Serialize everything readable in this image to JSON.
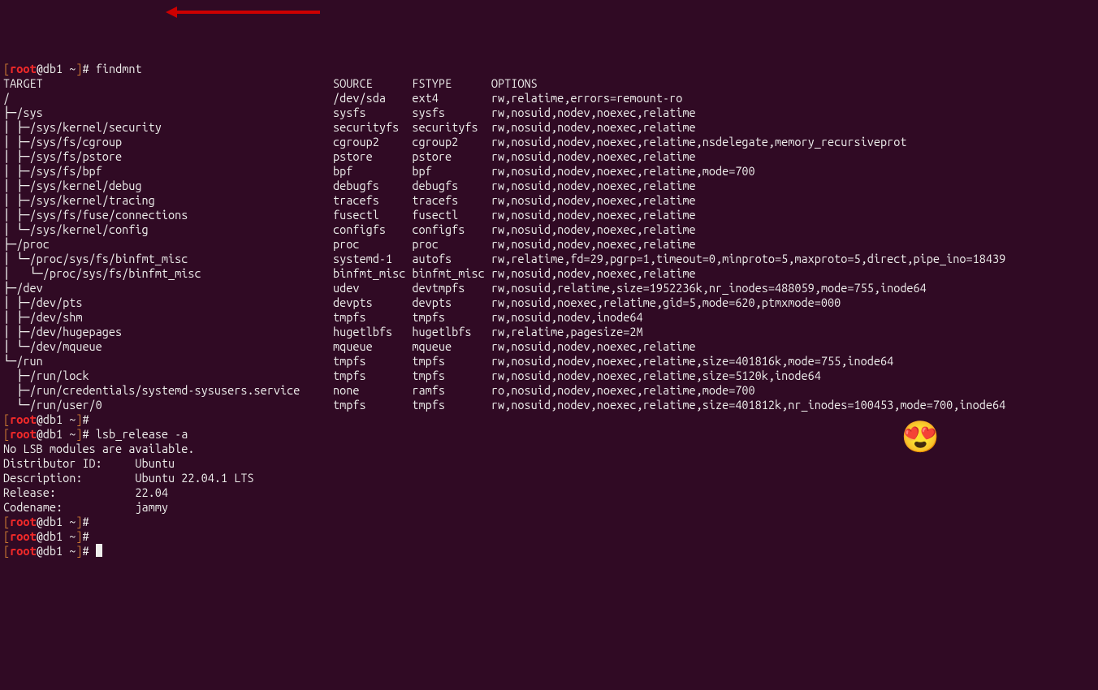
{
  "prompt": {
    "lb": "[",
    "user": "root",
    "at": "@",
    "host": "db1",
    "tilde": " ~",
    "rb": "]",
    "hash": "# "
  },
  "cmd1": "findmnt",
  "cmd2": "lsb_release -a",
  "header": {
    "target": "TARGET",
    "source": "SOURCE",
    "fstype": "FSTYPE",
    "options": "OPTIONS"
  },
  "rows": [
    {
      "t": "/",
      "s": "/dev/sda",
      "f": "ext4",
      "o": "rw,relatime,errors=remount-ro"
    },
    {
      "pre": "├─",
      "t": "/sys",
      "s": "sysfs",
      "f": "sysfs",
      "o": "rw,nosuid,nodev,noexec,relatime"
    },
    {
      "pre": "│ ├─",
      "t": "/sys/kernel/security",
      "s": "securityfs",
      "f": "securityfs",
      "o": "rw,nosuid,nodev,noexec,relatime"
    },
    {
      "pre": "│ ├─",
      "t": "/sys/fs/cgroup",
      "s": "cgroup2",
      "f": "cgroup2",
      "o": "rw,nosuid,nodev,noexec,relatime,nsdelegate,memory_recursiveprot"
    },
    {
      "pre": "│ ├─",
      "t": "/sys/fs/pstore",
      "s": "pstore",
      "f": "pstore",
      "o": "rw,nosuid,nodev,noexec,relatime"
    },
    {
      "pre": "│ ├─",
      "t": "/sys/fs/bpf",
      "s": "bpf",
      "f": "bpf",
      "o": "rw,nosuid,nodev,noexec,relatime,mode=700"
    },
    {
      "pre": "│ ├─",
      "t": "/sys/kernel/debug",
      "s": "debugfs",
      "f": "debugfs",
      "o": "rw,nosuid,nodev,noexec,relatime"
    },
    {
      "pre": "│ ├─",
      "t": "/sys/kernel/tracing",
      "s": "tracefs",
      "f": "tracefs",
      "o": "rw,nosuid,nodev,noexec,relatime"
    },
    {
      "pre": "│ ├─",
      "t": "/sys/fs/fuse/connections",
      "s": "fusectl",
      "f": "fusectl",
      "o": "rw,nosuid,nodev,noexec,relatime"
    },
    {
      "pre": "│ └─",
      "t": "/sys/kernel/config",
      "s": "configfs",
      "f": "configfs",
      "o": "rw,nosuid,nodev,noexec,relatime"
    },
    {
      "pre": "├─",
      "t": "/proc",
      "s": "proc",
      "f": "proc",
      "o": "rw,nosuid,nodev,noexec,relatime"
    },
    {
      "pre": "│ └─",
      "t": "/proc/sys/fs/binfmt_misc",
      "s": "systemd-1",
      "f": "autofs",
      "o": "rw,relatime,fd=29,pgrp=1,timeout=0,minproto=5,maxproto=5,direct,pipe_ino=18439"
    },
    {
      "pre": "│   └─",
      "t": "/proc/sys/fs/binfmt_misc",
      "s": "binfmt_misc",
      "f": "binfmt_misc",
      "o": "rw,nosuid,nodev,noexec,relatime"
    },
    {
      "pre": "├─",
      "t": "/dev",
      "s": "udev",
      "f": "devtmpfs",
      "o": "rw,nosuid,relatime,size=1952236k,nr_inodes=488059,mode=755,inode64"
    },
    {
      "pre": "│ ├─",
      "t": "/dev/pts",
      "s": "devpts",
      "f": "devpts",
      "o": "rw,nosuid,noexec,relatime,gid=5,mode=620,ptmxmode=000"
    },
    {
      "pre": "│ ├─",
      "t": "/dev/shm",
      "s": "tmpfs",
      "f": "tmpfs",
      "o": "rw,nosuid,nodev,inode64"
    },
    {
      "pre": "│ ├─",
      "t": "/dev/hugepages",
      "s": "hugetlbfs",
      "f": "hugetlbfs",
      "o": "rw,relatime,pagesize=2M"
    },
    {
      "pre": "│ └─",
      "t": "/dev/mqueue",
      "s": "mqueue",
      "f": "mqueue",
      "o": "rw,nosuid,nodev,noexec,relatime"
    },
    {
      "pre": "└─",
      "t": "/run",
      "s": "tmpfs",
      "f": "tmpfs",
      "o": "rw,nosuid,nodev,noexec,relatime,size=401816k,mode=755,inode64"
    },
    {
      "pre": "  ├─",
      "t": "/run/lock",
      "s": "tmpfs",
      "f": "tmpfs",
      "o": "rw,nosuid,nodev,noexec,relatime,size=5120k,inode64"
    },
    {
      "pre": "  ├─",
      "t": "/run/credentials/systemd-sysusers.service",
      "s": "none",
      "f": "ramfs",
      "o": "ro,nosuid,nodev,noexec,relatime,mode=700"
    },
    {
      "pre": "  └─",
      "t": "/run/user/0",
      "s": "tmpfs",
      "f": "tmpfs",
      "o": "rw,nosuid,nodev,noexec,relatime,size=401812k,nr_inodes=100453,mode=700,inode64"
    }
  ],
  "col": {
    "target_w": 50,
    "source_w": 12,
    "fstype_w": 12
  },
  "lsb": {
    "noModules": "No LSB modules are available.",
    "lines": [
      [
        "Distributor ID:",
        "Ubuntu"
      ],
      [
        "Description:",
        "Ubuntu 22.04.1 LTS"
      ],
      [
        "Release:",
        "22.04"
      ],
      [
        "Codename:",
        "jammy"
      ]
    ],
    "label_w": 20
  },
  "emoji": "😍"
}
